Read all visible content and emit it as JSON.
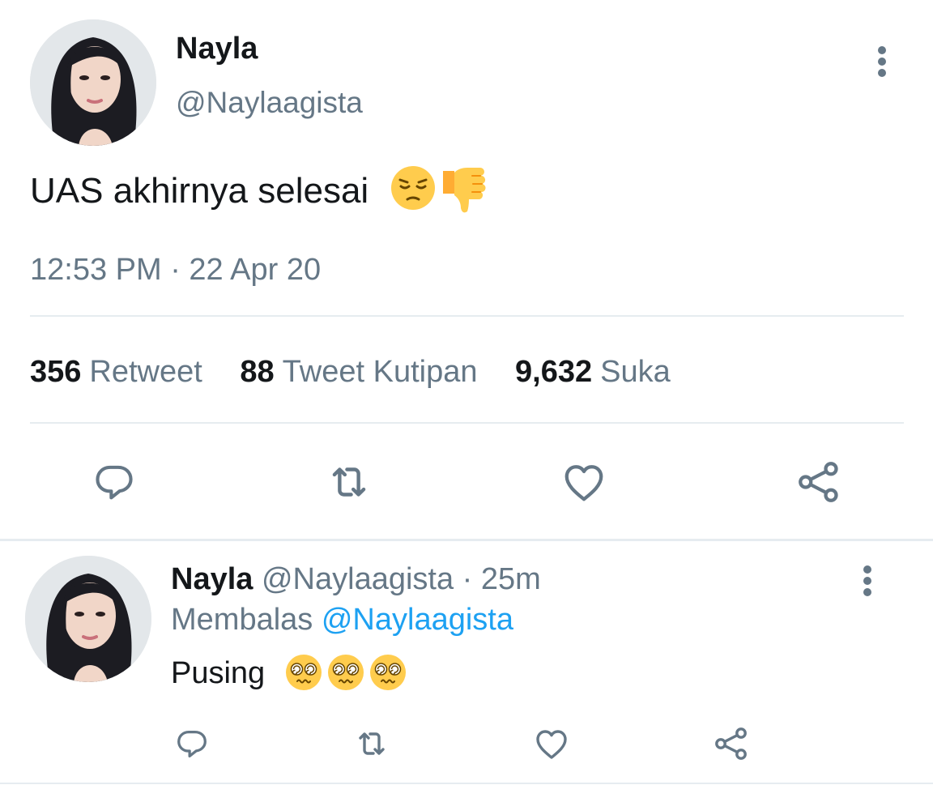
{
  "main_tweet": {
    "author": {
      "display_name": "Nayla",
      "handle": "@Naylaagista",
      "avatar": "profile-photo"
    },
    "text": "UAS akhirnya selesai",
    "emojis": [
      "pensive-face",
      "thumbs-down"
    ],
    "timestamp": "12:53 PM · 22 Apr 20",
    "stats": [
      {
        "count": "356",
        "label": "Retweet"
      },
      {
        "count": "88",
        "label": "Tweet Kutipan"
      },
      {
        "count": "9,632",
        "label": "Suka"
      }
    ],
    "actions": [
      "reply-icon",
      "retweet-icon",
      "like-icon",
      "share-icon"
    ],
    "more_icon": "more-vertical-icon"
  },
  "reply_tweet": {
    "author": {
      "display_name": "Nayla",
      "handle": "@Naylaagista",
      "avatar": "profile-photo"
    },
    "separator": "·",
    "time_ago": "25m",
    "replying_label": "Membalas",
    "replying_to": "@Naylaagista",
    "text": "Pusing",
    "emojis": [
      "dizzy-face",
      "dizzy-face",
      "dizzy-face"
    ],
    "actions": [
      "reply-icon",
      "retweet-icon",
      "like-icon",
      "share-icon"
    ],
    "more_icon": "more-vertical-icon"
  },
  "colors": {
    "text_primary": "#14171a",
    "text_secondary": "#657786",
    "link": "#1da1f2",
    "divider": "#e6ecf0",
    "emoji_yellow": "#ffcc4d"
  }
}
